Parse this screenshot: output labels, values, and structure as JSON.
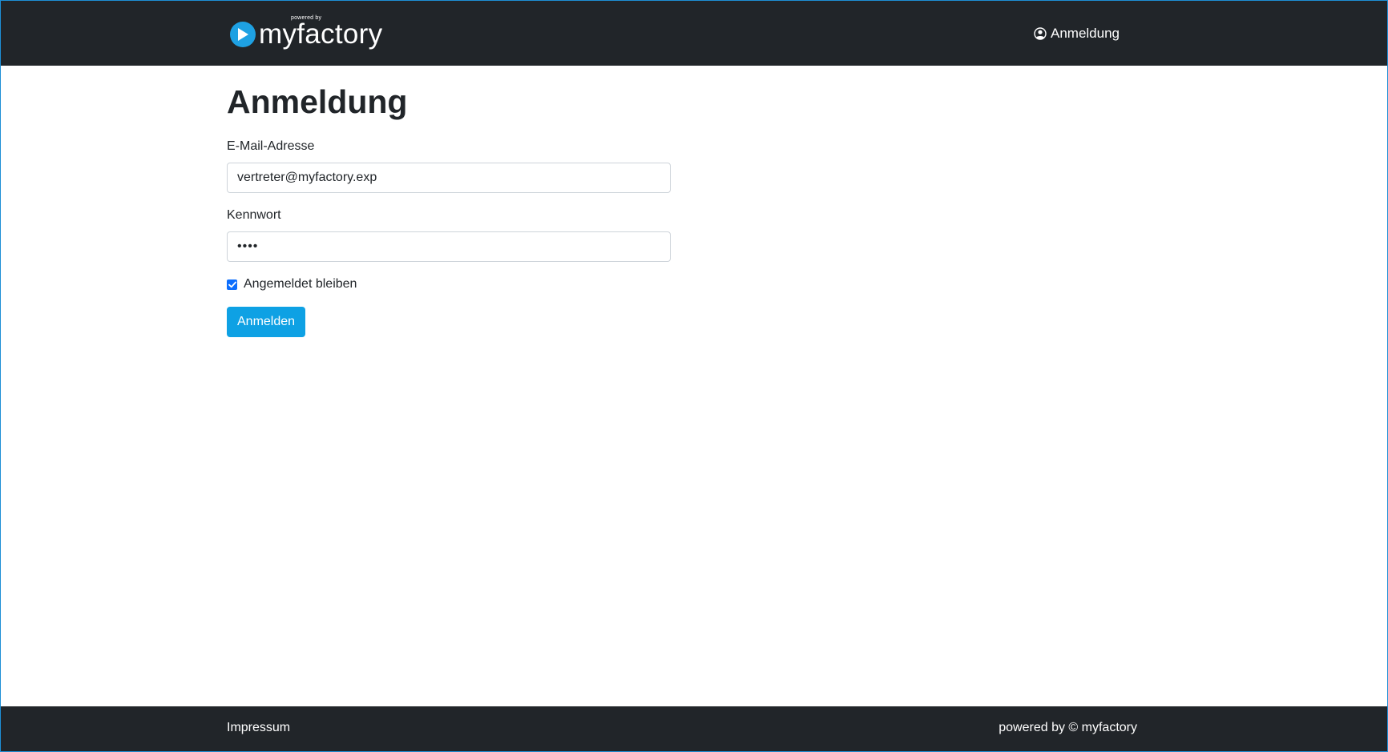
{
  "header": {
    "brand_small": "powered by",
    "brand_name": "myfactory",
    "nav_login_label": "Anmeldung"
  },
  "main": {
    "title": "Anmeldung",
    "email_label": "E-Mail-Adresse",
    "email_value": "vertreter@myfactory.exp",
    "password_label": "Kennwort",
    "password_value": "••••",
    "remember_label": "Angemeldet bleiben",
    "remember_checked": true,
    "submit_label": "Anmelden"
  },
  "footer": {
    "impressum_label": "Impressum",
    "credit": "powered by © myfactory"
  },
  "colors": {
    "header_bg": "#212529",
    "accent": "#0ea1e4",
    "checkbox": "#0d6efd"
  }
}
